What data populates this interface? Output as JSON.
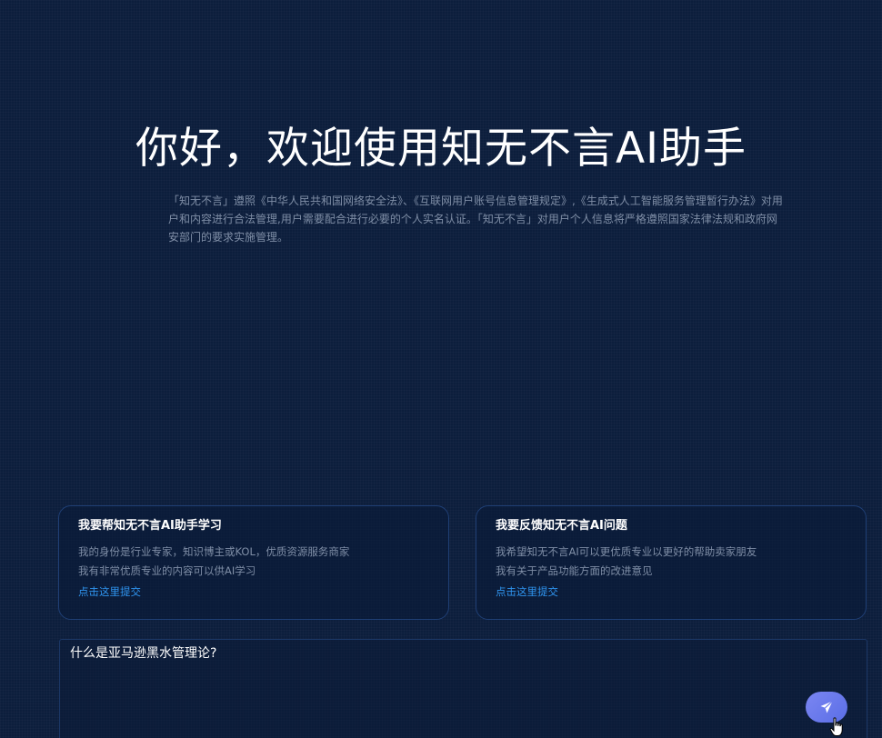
{
  "hero": {
    "title": "你好，欢迎使用知无不言AI助手",
    "notice": "「知无不言」遵照《中华人民共和国网络安全法》、《互联网用户账号信息管理规定》,《生成式人工智能服务管理暂行办法》对用户和内容进行合法管理,用户需要配合进行必要的个人实名认证。「知无不言」对用户个人信息将严格遵照国家法律法规和政府网安部门的要求实施管理。"
  },
  "cards": [
    {
      "title": "我要帮知无不言AI助手学习",
      "line1": "我的身份是行业专家，知识博主或KOL，优质资源服务商家",
      "line2": "我有非常优质专业的内容可以供AI学习",
      "link": "点击这里提交"
    },
    {
      "title": "我要反馈知无不言AI问题",
      "line1": "我希望知无不言AI可以更优质专业以更好的帮助卖家朋友",
      "line2": "我有关于产品功能方面的改进意见",
      "link": "点击这里提交"
    }
  ],
  "chat_input": {
    "value": "什么是亚马逊黑水管理论?"
  },
  "icons": {
    "send": "send-icon",
    "cursor": "hand-cursor-icon"
  },
  "colors": {
    "background": "#0c1e3c",
    "link": "#2f94ef",
    "send_button": "#6b7bee"
  }
}
